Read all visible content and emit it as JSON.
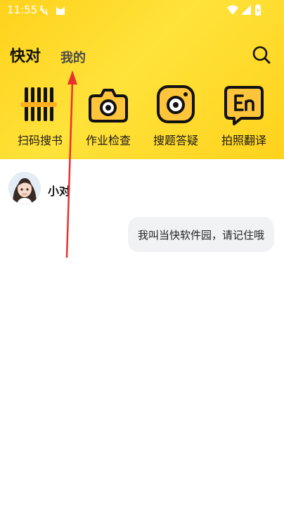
{
  "status_bar": {
    "time": "11:55",
    "icons": [
      "weather-icon",
      "cat-icon",
      "wifi-icon",
      "signal-icon",
      "battery-icon"
    ]
  },
  "tabs": [
    {
      "label": "快对",
      "active": true
    },
    {
      "label": "我的",
      "active": false
    }
  ],
  "tools": [
    {
      "label": "扫码搜书",
      "icon": "barcode-icon"
    },
    {
      "label": "作业检查",
      "icon": "camera-icon"
    },
    {
      "label": "搜题答疑",
      "icon": "instagram-camera-icon"
    },
    {
      "label": "拍照翻译",
      "icon": "translate-en-icon"
    }
  ],
  "chat": {
    "bot_name": "小对",
    "message": "我叫当快软件园，请记住哦"
  },
  "colors": {
    "header_yellow": "#ffd21c",
    "icon_orange": "#ffb020",
    "arrow_red": "#e8312f"
  }
}
